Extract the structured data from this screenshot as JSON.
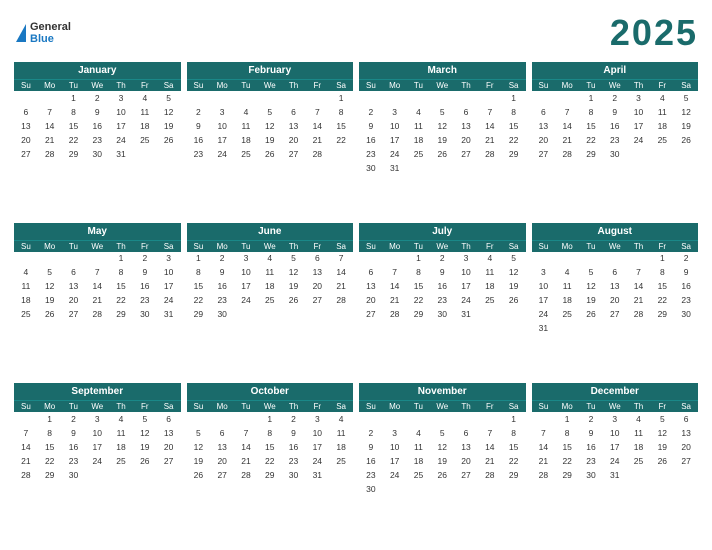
{
  "header": {
    "logo_general": "General",
    "logo_blue": "Blue",
    "year": "2025"
  },
  "months": [
    {
      "name": "January",
      "days": [
        "",
        "",
        "1",
        "2",
        "3",
        "4",
        "5",
        "6",
        "7",
        "8",
        "9",
        "10",
        "11",
        "12",
        "13",
        "14",
        "15",
        "16",
        "17",
        "18",
        "19",
        "20",
        "21",
        "22",
        "23",
        "24",
        "25",
        "26",
        "27",
        "28",
        "29",
        "30",
        "31",
        ""
      ]
    },
    {
      "name": "February",
      "days": [
        "",
        "",
        "",
        "",
        "",
        "",
        "1",
        "2",
        "3",
        "4",
        "5",
        "6",
        "7",
        "8",
        "9",
        "10",
        "11",
        "12",
        "13",
        "14",
        "15",
        "16",
        "17",
        "18",
        "19",
        "20",
        "21",
        "22",
        "23",
        "24",
        "25",
        "26",
        "27",
        "28",
        ""
      ]
    },
    {
      "name": "March",
      "days": [
        "",
        "",
        "",
        "",
        "",
        "",
        "1",
        "2",
        "3",
        "4",
        "5",
        "6",
        "7",
        "8",
        "9",
        "10",
        "11",
        "12",
        "13",
        "14",
        "15",
        "16",
        "17",
        "18",
        "19",
        "20",
        "21",
        "22",
        "23",
        "24",
        "25",
        "26",
        "27",
        "28",
        "29",
        "30",
        "31",
        "",
        "",
        "",
        "",
        ""
      ]
    },
    {
      "name": "April",
      "days": [
        "",
        "",
        "1",
        "2",
        "3",
        "4",
        "5",
        "6",
        "7",
        "8",
        "9",
        "10",
        "11",
        "12",
        "13",
        "14",
        "15",
        "16",
        "17",
        "18",
        "19",
        "20",
        "21",
        "22",
        "23",
        "24",
        "25",
        "26",
        "27",
        "28",
        "29",
        "30",
        "",
        "",
        ""
      ]
    },
    {
      "name": "May",
      "days": [
        "",
        "",
        "",
        "",
        "1",
        "2",
        "3",
        "4",
        "5",
        "6",
        "7",
        "8",
        "9",
        "10",
        "11",
        "12",
        "13",
        "14",
        "15",
        "16",
        "17",
        "18",
        "19",
        "20",
        "21",
        "22",
        "23",
        "24",
        "25",
        "26",
        "27",
        "28",
        "29",
        "30",
        "31"
      ]
    },
    {
      "name": "June",
      "days": [
        "1",
        "2",
        "3",
        "4",
        "5",
        "6",
        "7",
        "8",
        "9",
        "10",
        "11",
        "12",
        "13",
        "14",
        "15",
        "16",
        "17",
        "18",
        "19",
        "20",
        "21",
        "22",
        "23",
        "24",
        "25",
        "26",
        "27",
        "28",
        "29",
        "30",
        "",
        "",
        "",
        "",
        ""
      ]
    },
    {
      "name": "July",
      "days": [
        "",
        "",
        "1",
        "2",
        "3",
        "4",
        "5",
        "6",
        "7",
        "8",
        "9",
        "10",
        "11",
        "12",
        "13",
        "14",
        "15",
        "16",
        "17",
        "18",
        "19",
        "20",
        "21",
        "22",
        "23",
        "24",
        "25",
        "26",
        "27",
        "28",
        "29",
        "30",
        "31",
        "",
        ""
      ]
    },
    {
      "name": "August",
      "days": [
        "",
        "",
        "",
        "",
        "",
        "1",
        "2",
        "3",
        "4",
        "5",
        "6",
        "7",
        "8",
        "9",
        "10",
        "11",
        "12",
        "13",
        "14",
        "15",
        "16",
        "17",
        "18",
        "19",
        "20",
        "21",
        "22",
        "23",
        "24",
        "25",
        "26",
        "27",
        "28",
        "29",
        "30",
        "31",
        "",
        "",
        "",
        "",
        "",
        ""
      ]
    },
    {
      "name": "September",
      "days": [
        "",
        "1",
        "2",
        "3",
        "4",
        "5",
        "6",
        "7",
        "8",
        "9",
        "10",
        "11",
        "12",
        "13",
        "14",
        "15",
        "16",
        "17",
        "18",
        "19",
        "20",
        "21",
        "22",
        "23",
        "24",
        "25",
        "26",
        "27",
        "28",
        "29",
        "30",
        "",
        "",
        "",
        ""
      ]
    },
    {
      "name": "October",
      "days": [
        "",
        "",
        "",
        "1",
        "2",
        "3",
        "4",
        "5",
        "6",
        "7",
        "8",
        "9",
        "10",
        "11",
        "12",
        "13",
        "14",
        "15",
        "16",
        "17",
        "18",
        "19",
        "20",
        "21",
        "22",
        "23",
        "24",
        "25",
        "26",
        "27",
        "28",
        "29",
        "30",
        "31",
        ""
      ]
    },
    {
      "name": "November",
      "days": [
        "",
        "",
        "",
        "",
        "",
        "",
        "1",
        "2",
        "3",
        "4",
        "5",
        "6",
        "7",
        "8",
        "9",
        "10",
        "11",
        "12",
        "13",
        "14",
        "15",
        "16",
        "17",
        "18",
        "19",
        "20",
        "21",
        "22",
        "23",
        "24",
        "25",
        "26",
        "27",
        "28",
        "29",
        "30",
        "",
        "",
        "",
        "",
        "",
        ""
      ]
    },
    {
      "name": "December",
      "days": [
        "",
        "1",
        "2",
        "3",
        "4",
        "5",
        "6",
        "7",
        "8",
        "9",
        "10",
        "11",
        "12",
        "13",
        "14",
        "15",
        "16",
        "17",
        "18",
        "19",
        "20",
        "21",
        "22",
        "23",
        "24",
        "25",
        "26",
        "27",
        "28",
        "29",
        "30",
        "31",
        "",
        "",
        ""
      ]
    }
  ],
  "day_headers": [
    "Su",
    "Mo",
    "Tu",
    "We",
    "Th",
    "Fr",
    "Sa"
  ]
}
